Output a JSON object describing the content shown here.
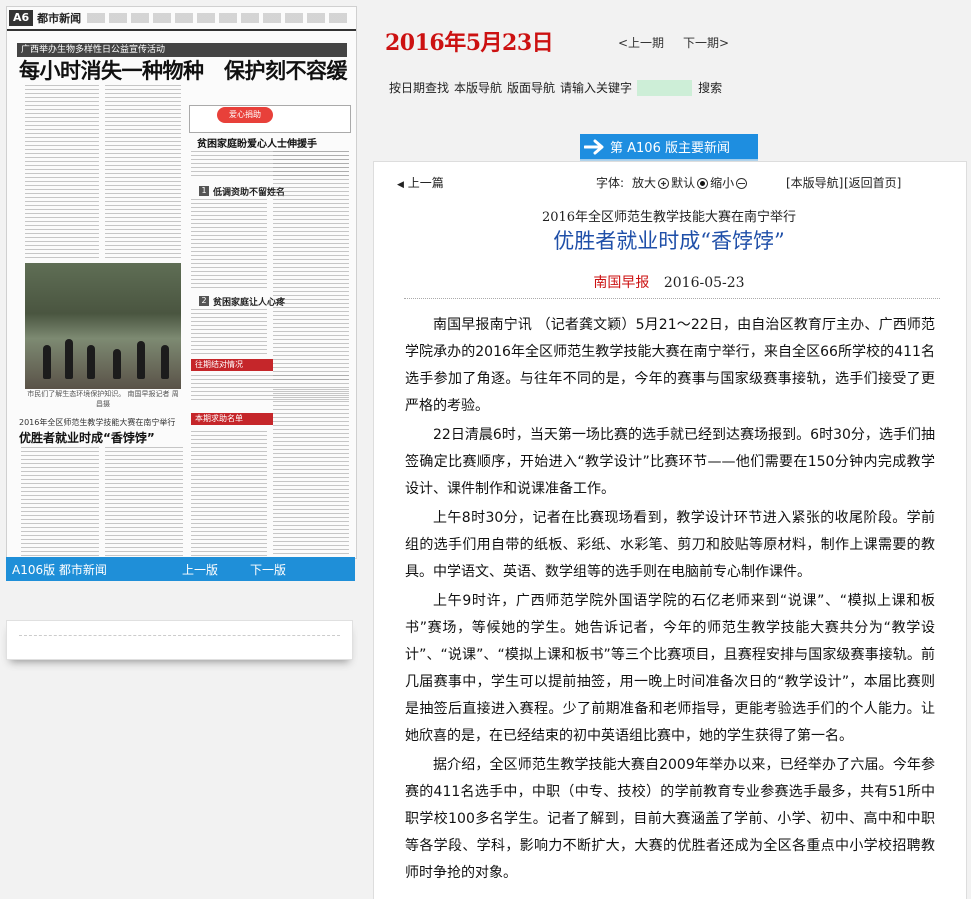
{
  "thumbnail": {
    "page_number": "A6",
    "section": "都市新闻",
    "headline_bar": "广西举办生物多样性日公益宣传活动",
    "headline": "每小时消失一种物种　保护刻不容缓",
    "love_logo": "爱心捐助",
    "right_headline": "贫困家庭盼爱心人士伸援手",
    "right_sub_a": "低调资助不留姓名",
    "right_sub_b": "贫困家庭让人心疼",
    "red_bar_a": "往期结对情况",
    "red_bar_b": "本期求助名单",
    "photo_caption": "市民们了解生态环境保护知识。 南国早报记者 周昌摄",
    "sub_kicker": "2016年全区师范生教学技能大赛在南宁举行",
    "sub_headline": "优胜者就业时成“香饽饽”"
  },
  "thumbnail_footer": {
    "page_label": "A106版 都市新闻",
    "prev_page": "上一版",
    "next_page": "下一版"
  },
  "header": {
    "date": "2016年5月23日",
    "prev_issue": "<上一期",
    "next_issue": "下一期>"
  },
  "nav": {
    "by_date": "按日期查找",
    "this_edition_nav": "本版导航",
    "layout_nav": "版面导航",
    "search_prompt": "请输入关键字",
    "search_value": "",
    "search_button": "搜索"
  },
  "edition_banner": "第 A106 版主要新闻",
  "toolbar": {
    "prev_article": "上一篇",
    "font_label": "字体:",
    "enlarge": "放大",
    "default": "默认",
    "shrink": "缩小",
    "version_nav": "[本版导航]",
    "home": "[返回首页]"
  },
  "article": {
    "kicker": "2016年全区师范生教学技能大赛在南宁举行",
    "title": "优胜者就业时成“香饽饽”",
    "source": "南国早报",
    "date": "2016-05-23",
    "paragraphs": [
      "南国早报南宁讯 （记者龚文颖）5月21～22日，由自治区教育厅主办、广西师范学院承办的2016年全区师范生教学技能大赛在南宁举行，来自全区66所学校的411名选手参加了角逐。与往年不同的是，今年的赛事与国家级赛事接轨，选手们接受了更严格的考验。",
      "22日清晨6时，当天第一场比赛的选手就已经到达赛场报到。6时30分，选手们抽签确定比赛顺序，开始进入“教学设计”比赛环节——他们需要在150分钟内完成教学设计、课件制作和说课准备工作。",
      "上午8时30分，记者在比赛现场看到，教学设计环节进入紧张的收尾阶段。学前组的选手们用自带的纸板、彩纸、水彩笔、剪刀和胶贴等原材料，制作上课需要的教具。中学语文、英语、数学组等的选手则在电脑前专心制作课件。",
      "上午9时许，广西师范学院外国语学院的石亿老师来到“说课”、“模拟上课和板书”赛场，等候她的学生。她告诉记者，今年的师范生教学技能大赛共分为“教学设计”、“说课”、“模拟上课和板书”等三个比赛项目，且赛程安排与国家级赛事接轨。前几届赛事中，学生可以提前抽签，用一晚上时间准备次日的“教学设计”，本届比赛则是抽签后直接进入赛程。少了前期准备和老师指导，更能考验选手们的个人能力。让她欣喜的是，在已经结束的初中英语组比赛中，她的学生获得了第一名。",
      "据介绍，全区师范生教学技能大赛自2009年举办以来，已经举办了六届。今年参赛的411名选手中，中职（中专、技校）的学前教育专业参赛选手最多，共有51所中职学校100多名学生。记者了解到，目前大赛涵盖了学前、小学、初中、高中和中职等各学段、学科，影响力不断扩大，大赛的优胜者还成为全区各重点中小学校招聘教师时争抢的对象。"
    ]
  }
}
